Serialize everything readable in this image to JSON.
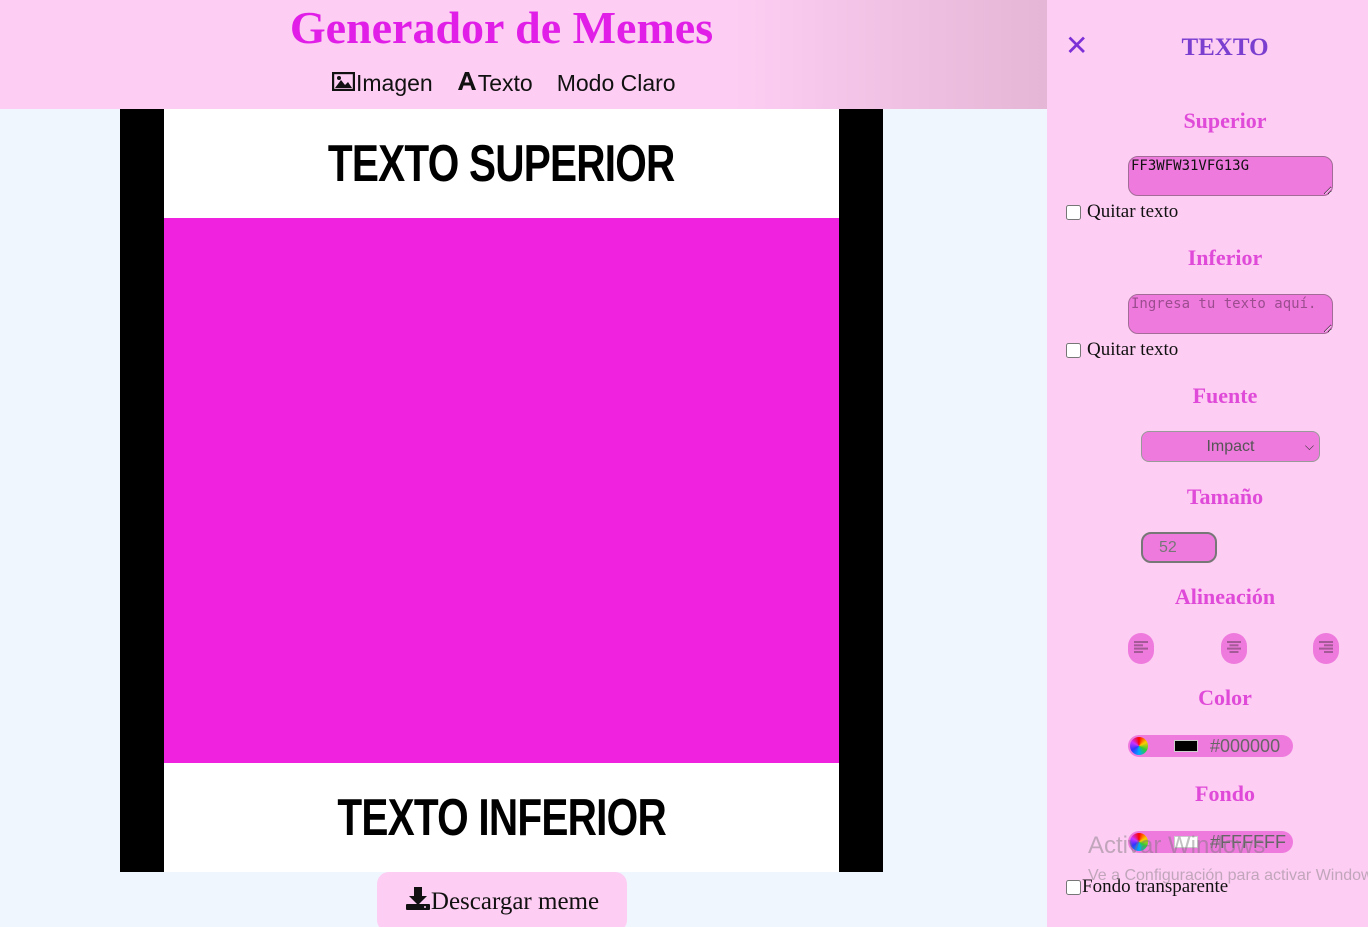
{
  "header": {
    "title": "Generador de Memes",
    "nav": {
      "image_label": "Imagen",
      "text_label": "Texto",
      "mode_label": "Modo Claro"
    }
  },
  "meme": {
    "top_text": "TEXTO SUPERIOR",
    "bottom_text": "TEXTO INFERIOR",
    "image_color": "#f121e0",
    "text_color": "#000000",
    "text_background": "#FFFFFF"
  },
  "download": {
    "label": "Descargar meme"
  },
  "panel": {
    "title": "TEXTO",
    "superior": {
      "heading": "Superior",
      "value": "FF3WFW31VFG13G",
      "remove_label": "Quitar texto"
    },
    "inferior": {
      "heading": "Inferior",
      "placeholder": "Ingresa tu texto aquí.",
      "remove_label": "Quitar texto"
    },
    "font": {
      "heading": "Fuente",
      "selected": "Impact"
    },
    "size": {
      "heading": "Tamaño",
      "value": "52"
    },
    "alignment": {
      "heading": "Alineación"
    },
    "color": {
      "heading": "Color",
      "value": "#000000"
    },
    "background": {
      "heading": "Fondo",
      "value": "#FFFFFF",
      "transparent_label": "Fondo transparente"
    }
  },
  "watermark": {
    "line1": "Activar Windows",
    "line2": "Ve a Configuración para activar Windows."
  }
}
